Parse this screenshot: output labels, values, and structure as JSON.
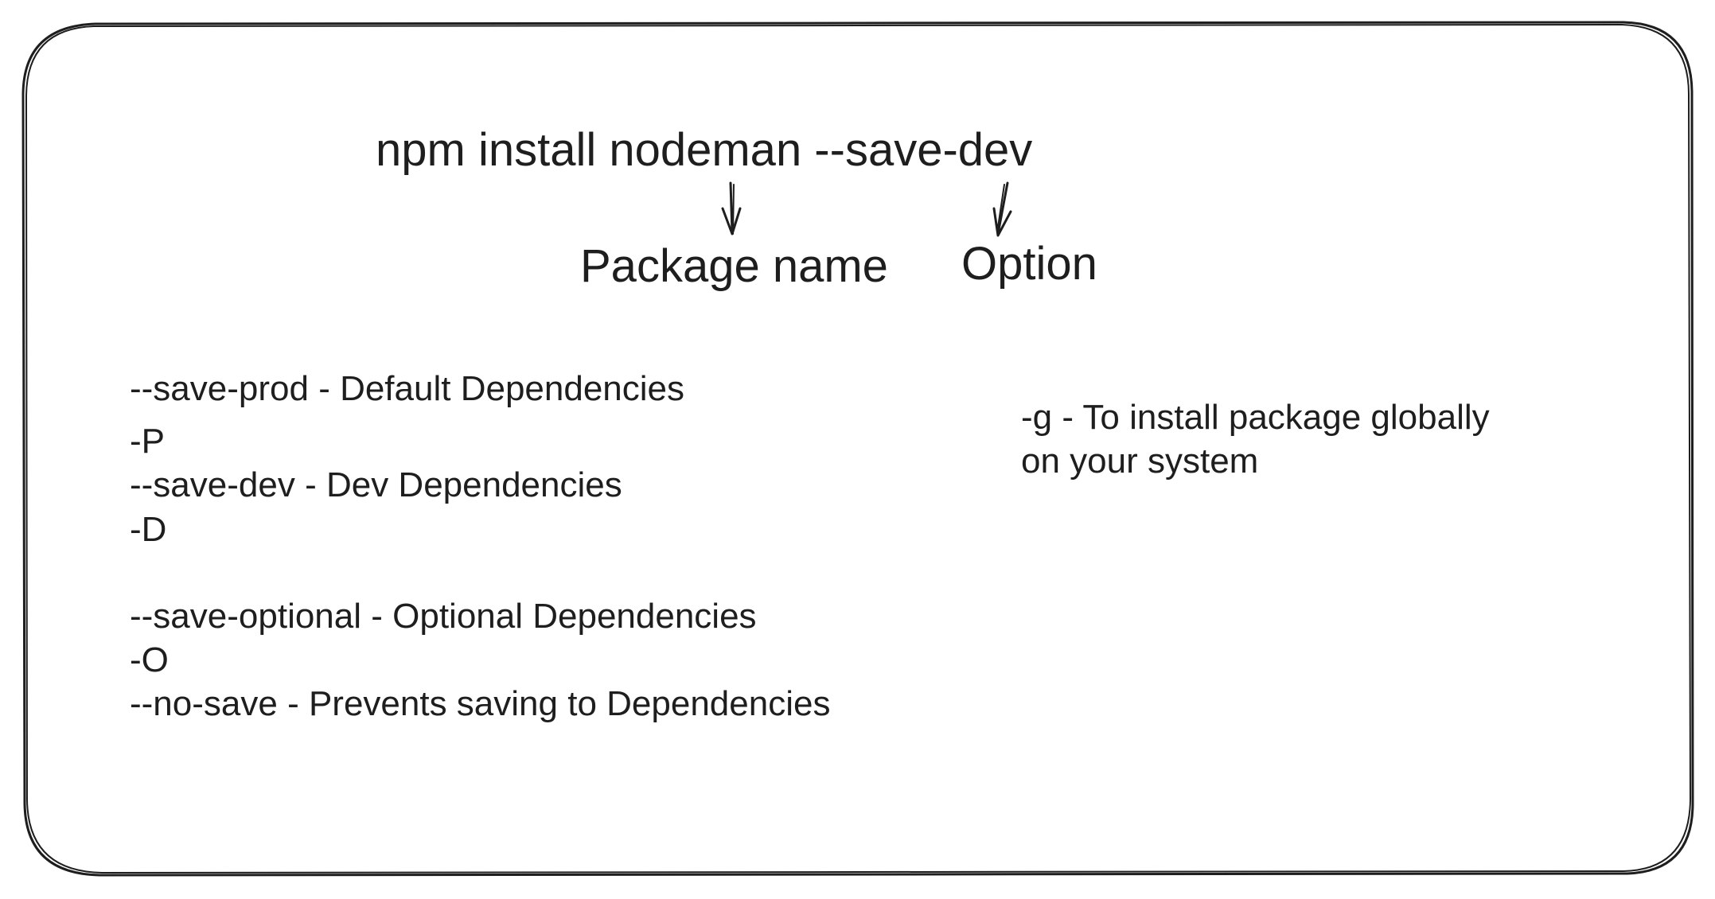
{
  "command": "npm install nodeman --save-dev",
  "labels": {
    "package_name": "Package name",
    "option": "Option"
  },
  "options": [
    "--save-prod - Default Dependencies",
    "-P",
    "--save-dev - Dev Dependencies",
    "-D",
    "--save-optional - Optional Dependencies",
    "-O",
    "--no-save - Prevents saving to Dependencies"
  ],
  "global_note": [
    "-g - To install package globally",
    "on your system"
  ],
  "colors": {
    "ink": "#1e1e1e",
    "background": "#ffffff"
  }
}
